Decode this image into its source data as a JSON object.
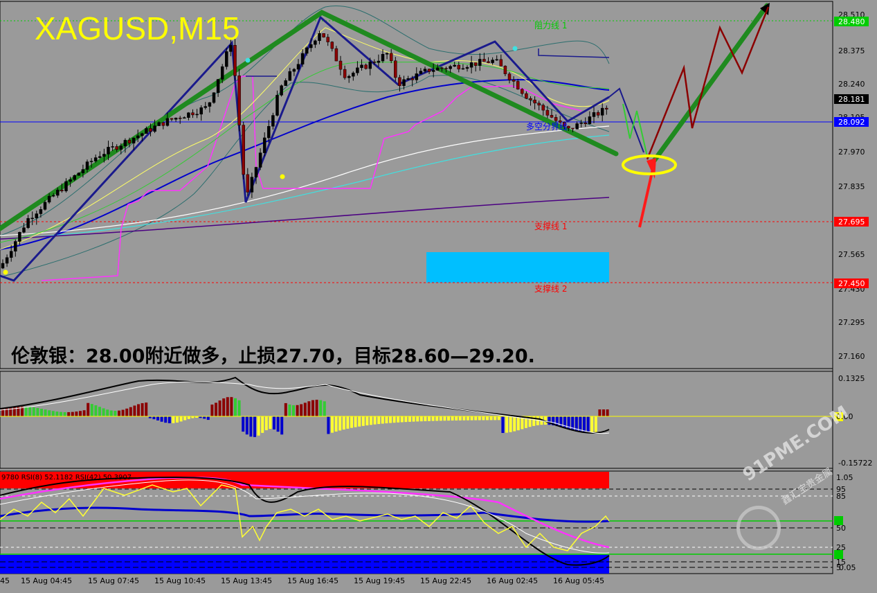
{
  "window": {
    "symbol_title": "XAGUSD,M15",
    "note_text": "伦敦银：28.00附近做多，止损27.70，目标28.60—29.20."
  },
  "colors": {
    "background": "#9a9a9a",
    "grid": "#000000",
    "bull_candle": "#000000",
    "bear_candle": "#8b0000",
    "trend_green": "#1f8a1f",
    "wave_navy": "#1a1a8c",
    "hline_blue": "#0000ff",
    "hline_red": "#ff0000",
    "hline_green": "#00cc00"
  },
  "price_panel": {
    "y_ticks": [
      "28.510",
      "28.375",
      "28.240",
      "28.105",
      "27.970",
      "27.835",
      "27.700",
      "27.565",
      "27.430",
      "27.295",
      "27.160"
    ],
    "price_tags": [
      {
        "label": "28.480",
        "color": "#00cc00"
      },
      {
        "label": "28.181",
        "color": "#000000"
      },
      {
        "label": "28.092",
        "color": "#0000ff"
      },
      {
        "label": "27.695",
        "color": "#ff0000"
      },
      {
        "label": "27.450",
        "color": "#ff0000"
      }
    ],
    "line_labels": {
      "resistance": "阻力线 1",
      "pivot": "多空分界线",
      "support1": "支撑线 1",
      "support2": "支撑线 2"
    }
  },
  "macd_panel": {
    "y_ticks": [
      "0.1325",
      "0.00",
      "-0.15722"
    ]
  },
  "rsi_panel": {
    "header_text": "9780  RSI(8) 52.1182  RSI(42) 50.3907",
    "y_ticks": [
      "1.05",
      "95",
      "85",
      "50",
      "25",
      "15",
      "5",
      "0.05"
    ]
  },
  "x_axis": {
    "labels": [
      "45",
      "15 Aug 04:45",
      "15 Aug 07:45",
      "15 Aug 10:45",
      "15 Aug 13:45",
      "15 Aug 16:45",
      "15 Aug 19:45",
      "15 Aug 22:45",
      "16 Aug 02:45",
      "16 Aug 05:45"
    ]
  },
  "watermark": {
    "text": "91PME.COM",
    "sub_text": "鑫汇宝贵金属"
  },
  "chart_data": {
    "type": "line",
    "title": "XAGUSD,M15",
    "ylim": [
      27.1,
      28.57
    ],
    "x": [
      "15 Aug 04:45",
      "15 Aug 07:45",
      "15 Aug 10:45",
      "15 Aug 13:45",
      "15 Aug 16:45",
      "15 Aug 19:45",
      "15 Aug 22:45",
      "16 Aug 02:45",
      "16 Aug 05:45"
    ],
    "series": [
      {
        "name": "",
        "values": [
          27.69,
          27.96,
          28.11,
          28.17,
          28.5,
          28.33,
          28.33,
          28.31,
          28.17
        ]
      }
    ],
    "hlines": [
      {
        "label": "阻力线 1",
        "value": 28.48
      },
      {
        "label": "多空分界线",
        "value": 28.092
      },
      {
        "label": "支撑线 1",
        "value": 27.695
      },
      {
        "label": "支撑线 2",
        "value": 27.45
      }
    ],
    "current_price": 28.181,
    "grid": false,
    "legend": "none"
  }
}
